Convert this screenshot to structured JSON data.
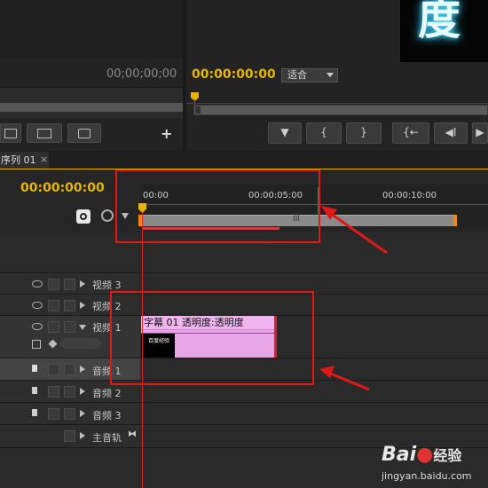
{
  "source_monitor": {
    "timecode": "00;00;00;00",
    "add_icon": "plus-icon"
  },
  "program_monitor": {
    "timecode": "00:00:00:00",
    "fit_select": "适合",
    "transport_buttons": [
      {
        "name": "marker-button",
        "glyph": "▼"
      },
      {
        "name": "mark-in-button",
        "glyph": "{"
      },
      {
        "name": "mark-out-button",
        "glyph": "}"
      },
      {
        "name": "go-to-in-button",
        "glyph": "{←"
      },
      {
        "name": "step-back-button",
        "glyph": "◀I"
      },
      {
        "name": "play-button",
        "glyph": "▶"
      }
    ],
    "preview_text": "度"
  },
  "timeline": {
    "tab_label": "序列 01",
    "tab_close": "×",
    "timecode": "00:00:00:00",
    "ruler_ticks": [
      "00:00",
      "00:00:05:00",
      "00:00:10:00"
    ],
    "scroll_handle": "III",
    "tracks": [
      {
        "id": "v3",
        "label": "视频 3",
        "kind": "video"
      },
      {
        "id": "v2",
        "label": "视频 2",
        "kind": "video"
      },
      {
        "id": "v1",
        "label": "视频 1",
        "kind": "video"
      },
      {
        "id": "a1",
        "label": "音频 1",
        "kind": "audio"
      },
      {
        "id": "a2",
        "label": "音频 2",
        "kind": "audio"
      },
      {
        "id": "a3",
        "label": "音频 3",
        "kind": "audio"
      },
      {
        "id": "master",
        "label": "主音轨",
        "kind": "master"
      }
    ],
    "clip": {
      "name": "字幕 01",
      "effect": "透明度:透明度",
      "thumb_text": "百度经验"
    }
  },
  "watermark": {
    "brand": "Bai",
    "brand2": "经验",
    "url": "jingyan.baidu.com"
  },
  "colors": {
    "accent_timecode": "#e8b400",
    "clip_pink": "#e6a6e6",
    "playhead": "#d42a2a",
    "annotation_red": "#e01818"
  }
}
